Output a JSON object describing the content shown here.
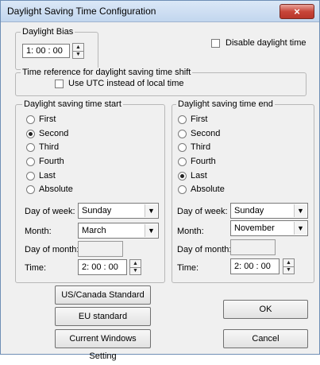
{
  "window": {
    "title": "Daylight Saving Time Configuration",
    "close_glyph": "×"
  },
  "daylight_bias": {
    "legend": "Daylight Bias",
    "value": "1: 00 : 00"
  },
  "disable_daylight": {
    "label": "Disable daylight time",
    "checked": false
  },
  "time_reference": {
    "legend": "Time reference for daylight saving time shift",
    "use_utc_label": "Use UTC instead of local time",
    "use_utc_checked": false
  },
  "dst_start": {
    "legend": "Daylight saving time start",
    "options": [
      "First",
      "Second",
      "Third",
      "Fourth",
      "Last",
      "Absolute"
    ],
    "selected": "Second",
    "day_of_week_label": "Day of week:",
    "day_of_week": "Sunday",
    "month_label": "Month:",
    "month": "March",
    "day_of_month_label": "Day of month:",
    "day_of_month": "",
    "time_label": "Time:",
    "time": "2: 00 : 00"
  },
  "dst_end": {
    "legend": "Daylight saving time end",
    "options": [
      "First",
      "Second",
      "Third",
      "Fourth",
      "Last",
      "Absolute"
    ],
    "selected": "Last",
    "day_of_week_label": "Day of week:",
    "day_of_week": "Sunday",
    "month_label": "Month:",
    "month": "November",
    "day_of_month_label": "Day of month:",
    "day_of_month": "",
    "time_label": "Time:",
    "time": "2: 00 : 00"
  },
  "buttons": {
    "us_canada": "US/Canada Standard",
    "eu": "EU standard",
    "current_windows": "Current Windows Setting",
    "ok": "OK",
    "cancel": "Cancel"
  },
  "icons": {
    "close": "close-icon",
    "spin_up": "chevron-up-icon",
    "spin_down": "chevron-down-icon",
    "dropdown": "dropdown-arrow-icon"
  }
}
